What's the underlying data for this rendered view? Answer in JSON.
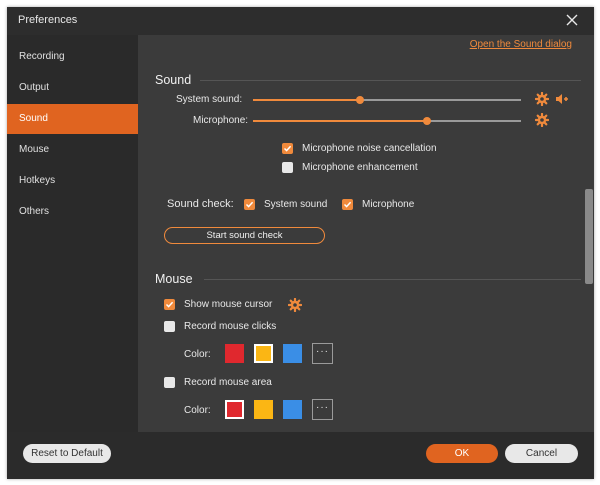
{
  "window": {
    "title": "Preferences"
  },
  "sidebar": {
    "items": [
      {
        "label": "Recording",
        "active": false
      },
      {
        "label": "Output",
        "active": false
      },
      {
        "label": "Sound",
        "active": true
      },
      {
        "label": "Mouse",
        "active": false
      },
      {
        "label": "Hotkeys",
        "active": false
      },
      {
        "label": "Others",
        "active": false
      }
    ]
  },
  "sound": {
    "link_label": "Open the Sound dialog",
    "title": "Sound",
    "system_sound": {
      "label": "System sound:",
      "level": 0.4
    },
    "microphone": {
      "label": "Microphone:",
      "level": 0.65
    },
    "noise_cancellation": {
      "label": "Microphone noise cancellation",
      "checked": true
    },
    "enhancement": {
      "label": "Microphone enhancement",
      "checked": false
    },
    "sound_check": {
      "label": "Sound check:",
      "system_sound": {
        "label": "System sound",
        "checked": true
      },
      "microphone": {
        "label": "Microphone",
        "checked": true
      }
    },
    "start_check_label": "Start sound check"
  },
  "mouse": {
    "title": "Mouse",
    "show_cursor": {
      "label": "Show mouse cursor",
      "checked": true
    },
    "record_clicks": {
      "label": "Record mouse clicks",
      "checked": false
    },
    "clicks_color": {
      "label": "Color:",
      "selected": 1
    },
    "record_area": {
      "label": "Record mouse area",
      "checked": false
    },
    "area_color": {
      "label": "Color:",
      "selected": 0
    },
    "colors": [
      "#e0282e",
      "#fbb614",
      "#3a8ee6"
    ],
    "more_label": "···"
  },
  "footer": {
    "reset_label": "Reset to Default",
    "ok_label": "OK",
    "cancel_label": "Cancel"
  },
  "theme": {
    "accent": "#f08a3c",
    "active_item": "#e06420"
  }
}
